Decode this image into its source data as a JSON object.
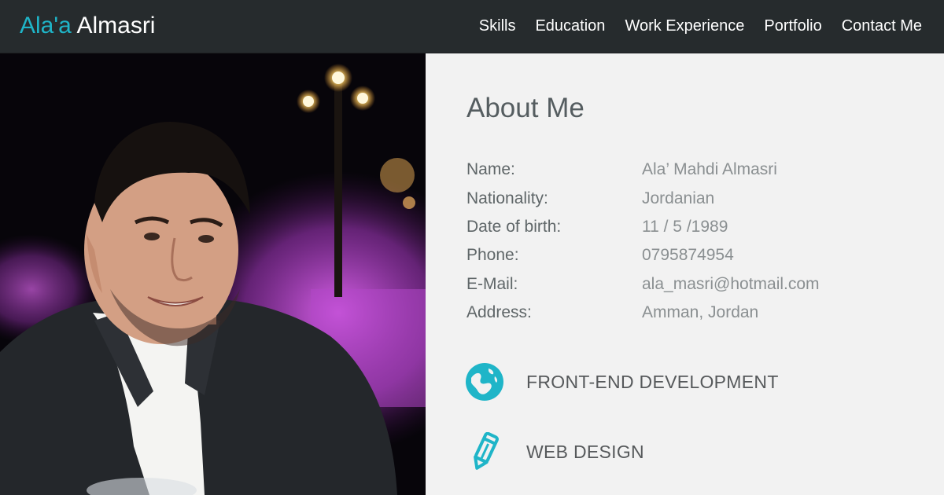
{
  "brand": {
    "first": "Ala'a",
    "last": "Almasri"
  },
  "nav": {
    "items": [
      {
        "label": "Skills"
      },
      {
        "label": "Education"
      },
      {
        "label": "Work Experience"
      },
      {
        "label": "Portfolio"
      },
      {
        "label": "Contact Me"
      }
    ]
  },
  "about": {
    "title": "About Me",
    "fields": [
      {
        "label": "Name:",
        "value": "Ala’ Mahdi Almasri"
      },
      {
        "label": "Nationality:",
        "value": "Jordanian"
      },
      {
        "label": "Date of birth:",
        "value": "11 / 5 /1989"
      },
      {
        "label": "Phone:",
        "value": "0795874954"
      },
      {
        "label": "E-Mail:",
        "value": "ala_masri@hotmail.com"
      },
      {
        "label": "Address:",
        "value": "Amman, Jordan"
      }
    ]
  },
  "skills": [
    {
      "label": "FRONT-END DEVELOPMENT",
      "icon": "globe-icon"
    },
    {
      "label": "WEB DESIGN",
      "icon": "pencil-icon"
    }
  ],
  "colors": {
    "accent": "#1fb5c8",
    "navbar": "#262b2d",
    "panel": "#f2f2f2"
  }
}
